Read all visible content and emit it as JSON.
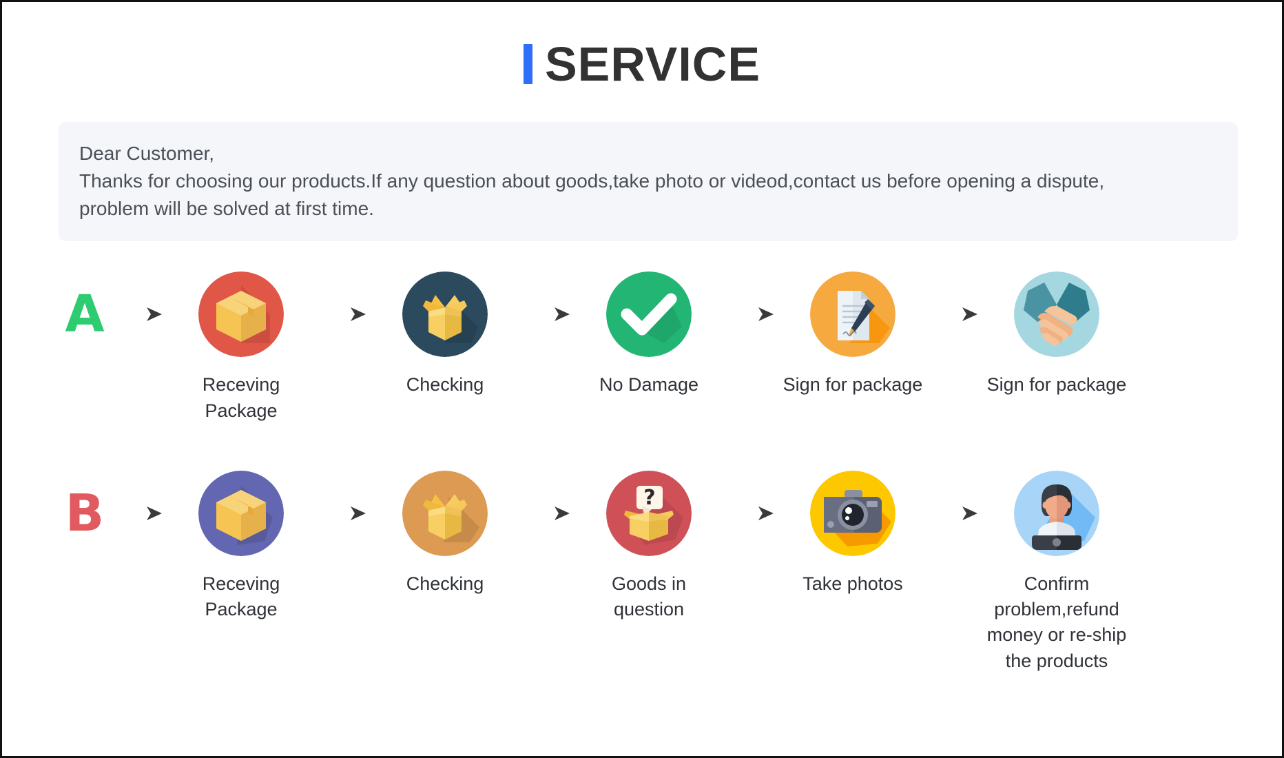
{
  "header": {
    "title": "SERVICE",
    "accent_color": "#2f6dfb",
    "title_color": "#323232"
  },
  "notice": {
    "background_color": "#f4f6fa",
    "lines": [
      "Dear Customer,",
      "Thanks for choosing our products.If any question about goods,take photo or videod,contact us before opening a dispute,",
      "problem will be solved at first time."
    ]
  },
  "flows": [
    {
      "badge": "A",
      "badge_color": "#2ecc71",
      "steps": [
        {
          "icon": "closed-box-icon",
          "circle_color": "#e05647",
          "label": "Receving Package"
        },
        {
          "icon": "open-box-icon",
          "circle_color": "#2c4a5e",
          "label": "Checking"
        },
        {
          "icon": "checkmark-icon",
          "circle_color": "#22b573",
          "label": "No Damage"
        },
        {
          "icon": "document-pen-icon",
          "circle_color": "#f5a93f",
          "label": "Sign for package"
        },
        {
          "icon": "handshake-icon",
          "circle_color": "#a5d7e0",
          "label": "Sign for package"
        }
      ]
    },
    {
      "badge": "B",
      "badge_color": "#e05a5f",
      "steps": [
        {
          "icon": "closed-box-icon",
          "circle_color": "#6366b0",
          "label": "Receving Package"
        },
        {
          "icon": "open-box-icon",
          "circle_color": "#dd9a52",
          "label": "Checking"
        },
        {
          "icon": "question-box-icon",
          "circle_color": "#cf5157",
          "label": "Goods in question"
        },
        {
          "icon": "camera-icon",
          "circle_color": "#fdc800",
          "label": "Take photos"
        },
        {
          "icon": "support-person-icon",
          "circle_color": "#a8d5f7",
          "label": "Confirm problem,refund money or re-ship the products"
        }
      ]
    }
  ],
  "arrow": {
    "name": "right-arrow-icon",
    "color": "#4a4a4a"
  }
}
